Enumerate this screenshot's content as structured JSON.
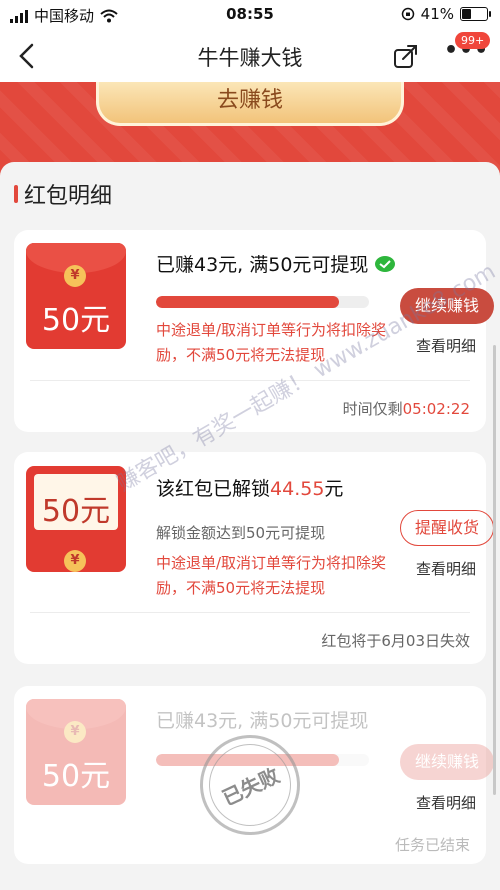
{
  "status_bar": {
    "carrier": "中国移动",
    "time": "08:55",
    "battery_pct": "41%",
    "battery_level": 0.41
  },
  "nav": {
    "title": "牛牛赚大钱",
    "badge": "99+"
  },
  "banner": {
    "cta": "去赚钱"
  },
  "section": {
    "title": "红包明细"
  },
  "cards": [
    {
      "env_amount": "50元",
      "headline": "已赚43元, 满50元可提现",
      "progress": 0.86,
      "warning": "中途退单/取消订单等行为将扣除奖励，不满50元将无法提现",
      "button": "继续赚钱",
      "detail_link": "查看明细",
      "footer_prefix": "时间仅剩",
      "footer_value": "05:02:22"
    },
    {
      "env_amount": "50元",
      "headline_prefix": "该红包已解锁",
      "headline_amount": "44.55",
      "headline_suffix": "元",
      "sub": "解锁金额达到50元可提现",
      "warning": "中途退单/取消订单等行为将扣除奖励，不满50元将无法提现",
      "button": "提醒收货",
      "detail_link": "查看明细",
      "footer": "红包将于6月03日失效"
    },
    {
      "env_amount": "50元",
      "headline": "已赚43元, 满50元可提现",
      "progress": 0.86,
      "button": "继续赚钱",
      "detail_link": "查看明细",
      "footer": "任务已结束",
      "stamp": "已失败"
    }
  ],
  "watermark": "赚客吧，有奖一起赚！ www.zuanke8.com",
  "colors": {
    "accent": "#e2483c",
    "button": "#c94c3f"
  }
}
